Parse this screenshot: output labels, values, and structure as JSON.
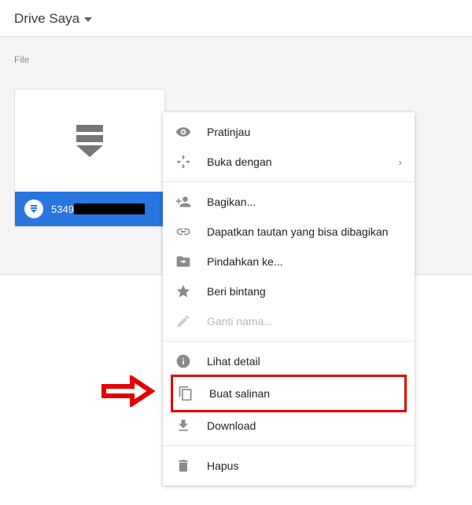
{
  "header": {
    "title": "Drive Saya"
  },
  "section_label": "File",
  "file": {
    "name_prefix": "5349"
  },
  "menu": {
    "preview": "Pratinjau",
    "open_with": "Buka dengan",
    "share": "Bagikan...",
    "get_link": "Dapatkan tautan yang bisa dibagikan",
    "move_to": "Pindahkan ke...",
    "star": "Beri bintang",
    "rename": "Ganti nama...",
    "details": "Lihat detail",
    "make_copy": "Buat salinan",
    "download": "Download",
    "delete": "Hapus"
  }
}
